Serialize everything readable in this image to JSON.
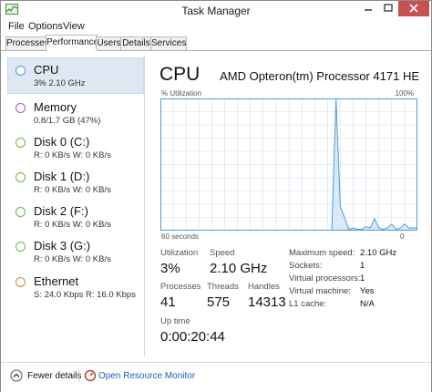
{
  "window": {
    "title": "Task Manager"
  },
  "menu": {
    "items": [
      "File",
      "Options",
      "View"
    ]
  },
  "tabs": [
    "Processes",
    "Performance",
    "Users",
    "Details",
    "Services"
  ],
  "active_tab": "Performance",
  "sidebar": {
    "items": [
      {
        "name": "CPU",
        "detail": "3% 2.10 GHz",
        "color": "#4f9bd8",
        "selected": true
      },
      {
        "name": "Memory",
        "detail": "0.8/1.7 GB (47%)",
        "color": "#a45bb6",
        "selected": false
      },
      {
        "name": "Disk 0 (C:)",
        "detail": "R: 0 KB/s W: 0 KB/s",
        "color": "#6db33f",
        "selected": false
      },
      {
        "name": "Disk 1 (D:)",
        "detail": "R: 0 KB/s W: 0 KB/s",
        "color": "#6db33f",
        "selected": false
      },
      {
        "name": "Disk 2 (F:)",
        "detail": "R: 0 KB/s W: 0 KB/s",
        "color": "#6db33f",
        "selected": false
      },
      {
        "name": "Disk 3 (G:)",
        "detail": "R: 0 KB/s W: 0 KB/s",
        "color": "#6db33f",
        "selected": false
      },
      {
        "name": "Ethernet",
        "detail": "S: 24.0 Kbps R: 16.0 Kbps",
        "color": "#c8864a",
        "selected": false
      }
    ]
  },
  "main": {
    "title": "CPU",
    "model": "AMD Opteron(tm) Processor 4171 HE",
    "graph": {
      "y_label": "% Utilization",
      "y_max_label": "100%",
      "x_label": "60 seconds",
      "x_min_label": "0",
      "line_color": "#4f9bd8",
      "fill_color": "#dbe9f6",
      "border_color": "#4f9bd8",
      "grid_color": "#cfe0ef",
      "values": [
        0,
        0,
        0,
        0,
        0,
        0,
        0,
        0,
        0,
        0,
        0,
        0,
        0,
        0,
        0,
        0,
        0,
        0,
        0,
        0,
        0,
        0,
        0,
        0,
        0,
        0,
        0,
        0,
        0,
        0,
        0,
        0,
        0,
        0,
        0,
        0,
        0,
        0,
        0,
        0,
        0,
        100,
        18,
        10,
        1,
        2,
        1,
        1,
        3,
        2,
        9,
        2,
        1,
        2,
        5,
        1,
        2,
        5,
        2,
        2,
        2
      ]
    },
    "stats": {
      "utilization_label": "Utilization",
      "utilization": "3%",
      "speed_label": "Speed",
      "speed": "2.10 GHz",
      "processes_label": "Processes",
      "processes": "41",
      "threads_label": "Threads",
      "threads": "575",
      "handles_label": "Handles",
      "handles": "14313",
      "uptime_label": "Up time",
      "uptime": "0:00:20:44"
    },
    "specs": [
      {
        "key": "Maximum speed:",
        "value": "2.10 GHz"
      },
      {
        "key": "Sockets:",
        "value": "1"
      },
      {
        "key": "Virtual processors:",
        "value": "1"
      },
      {
        "key": "Virtual machine:",
        "value": "Yes"
      },
      {
        "key": "L1 cache:",
        "value": "N/A"
      }
    ]
  },
  "footer": {
    "fewer_details": "Fewer details",
    "open_monitor": "Open Resource Monitor"
  }
}
